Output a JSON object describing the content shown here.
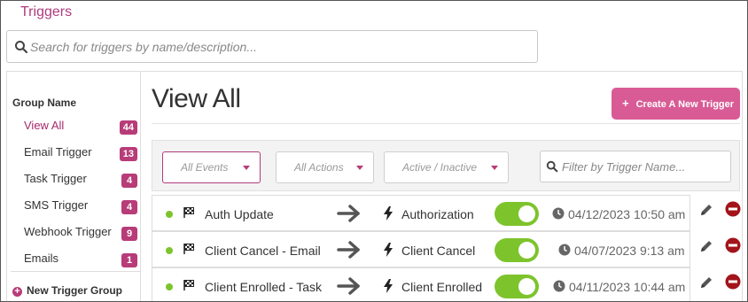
{
  "app": {
    "title": "Triggers"
  },
  "search": {
    "placeholder": "Search for triggers by name/description..."
  },
  "sidebar": {
    "heading": "Group Name",
    "items": [
      {
        "label": "View All",
        "count": "44",
        "active": true
      },
      {
        "label": "Email Trigger",
        "count": "13"
      },
      {
        "label": "Task Trigger",
        "count": "4"
      },
      {
        "label": "SMS Trigger",
        "count": "4"
      },
      {
        "label": "Webhook Trigger",
        "count": "9"
      },
      {
        "label": "Emails",
        "count": "1"
      }
    ],
    "new_group_label": "New Trigger Group"
  },
  "main": {
    "title": "View All",
    "create_button": "Create A New Trigger",
    "filters": {
      "events": "All Events",
      "actions": "All Actions",
      "status": "Active / Inactive",
      "name_placeholder": "Filter by Trigger Name..."
    },
    "triggers": [
      {
        "name": "Auth Update",
        "event": "Authorization",
        "active": true,
        "date": "04/12/2023 10:50 am"
      },
      {
        "name": "Client Cancel - Email",
        "event": "Client Cancel",
        "active": true,
        "date": "04/07/2023 9:13 am"
      },
      {
        "name": "Client Enrolled - Task",
        "event": "Client Enrolled",
        "active": true,
        "date": "04/11/2023 10:44 am"
      }
    ]
  },
  "colors": {
    "brand": "#b73c78",
    "create_button": "#d95b96",
    "active_green": "#7dc42c",
    "delete_red": "#a3141b"
  },
  "icons": {
    "search": "search-icon",
    "flag": "checkered-flag-icon",
    "arrow": "arrow-right-icon",
    "bolt": "lightning-bolt-icon",
    "clock": "clock-icon",
    "edit": "pencil-icon",
    "delete": "minus-circle-icon"
  }
}
